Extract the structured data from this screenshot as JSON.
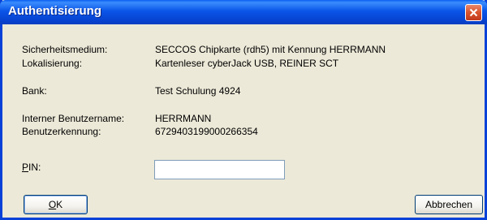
{
  "window": {
    "title": "Authentisierung"
  },
  "fields": {
    "security_medium_label": "Sicherheitsmedium:",
    "security_medium_value": "SECCOS Chipkarte (rdh5) mit Kennung HERRMANN",
    "localization_label": "Lokalisierung:",
    "localization_value": "Kartenleser cyberJack USB, REINER SCT",
    "bank_label": "Bank:",
    "bank_value": "Test Schulung 4924",
    "internal_username_label": "Interner Benutzername:",
    "internal_username_value": "HERRMANN",
    "user_id_label": "Benutzerkennung:",
    "user_id_value": "6729403199000266354",
    "pin_label_mnemonic": "P",
    "pin_label_rest": "IN:",
    "pin_value": ""
  },
  "buttons": {
    "ok_mnemonic": "O",
    "ok_rest": "K",
    "cancel_label": "Abbrechen"
  },
  "icons": {
    "close": "close-icon"
  },
  "colors": {
    "titlebar": "#0a55e8",
    "close_button": "#d9532c",
    "dialog_background": "#ece9d8"
  }
}
